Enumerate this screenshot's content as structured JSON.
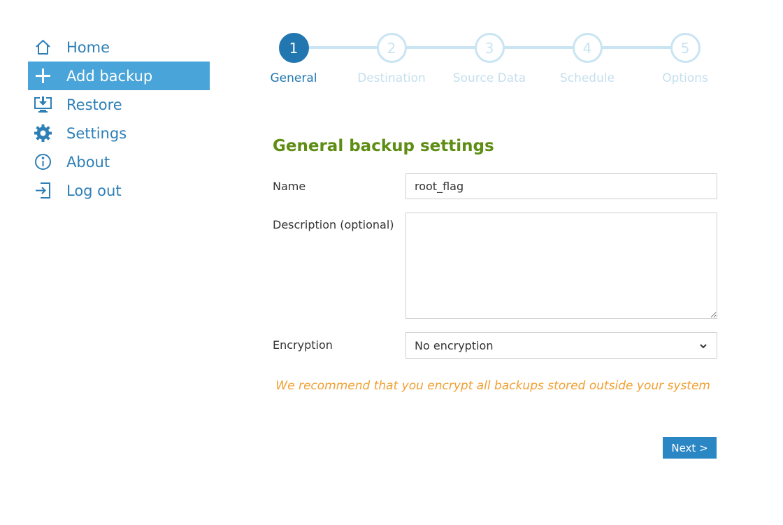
{
  "sidebar": {
    "items": [
      {
        "label": "Home",
        "icon": "home-icon",
        "active": false
      },
      {
        "label": "Add backup",
        "icon": "plus-icon",
        "active": true
      },
      {
        "label": "Restore",
        "icon": "restore-icon",
        "active": false
      },
      {
        "label": "Settings",
        "icon": "gear-icon",
        "active": false
      },
      {
        "label": "About",
        "icon": "info-icon",
        "active": false
      },
      {
        "label": "Log out",
        "icon": "logout-icon",
        "active": false
      }
    ]
  },
  "stepper": {
    "steps": [
      {
        "number": "1",
        "label": "General",
        "active": true
      },
      {
        "number": "2",
        "label": "Destination",
        "active": false
      },
      {
        "number": "3",
        "label": "Source Data",
        "active": false
      },
      {
        "number": "4",
        "label": "Schedule",
        "active": false
      },
      {
        "number": "5",
        "label": "Options",
        "active": false
      }
    ]
  },
  "form": {
    "title": "General backup settings",
    "name": {
      "label": "Name",
      "value": "root_flag"
    },
    "description": {
      "label": "Description (optional)",
      "value": ""
    },
    "encryption": {
      "label": "Encryption",
      "value": "No encryption"
    },
    "warning": "We recommend that you encrypt all backups stored outside your system",
    "next_label": "Next >"
  },
  "colors": {
    "accent": "#2277b0",
    "sidebar_active": "#49a4d9",
    "title_green": "#5e8d14",
    "warning_orange": "#f0a033",
    "step_inactive": "#c9e4f3"
  }
}
